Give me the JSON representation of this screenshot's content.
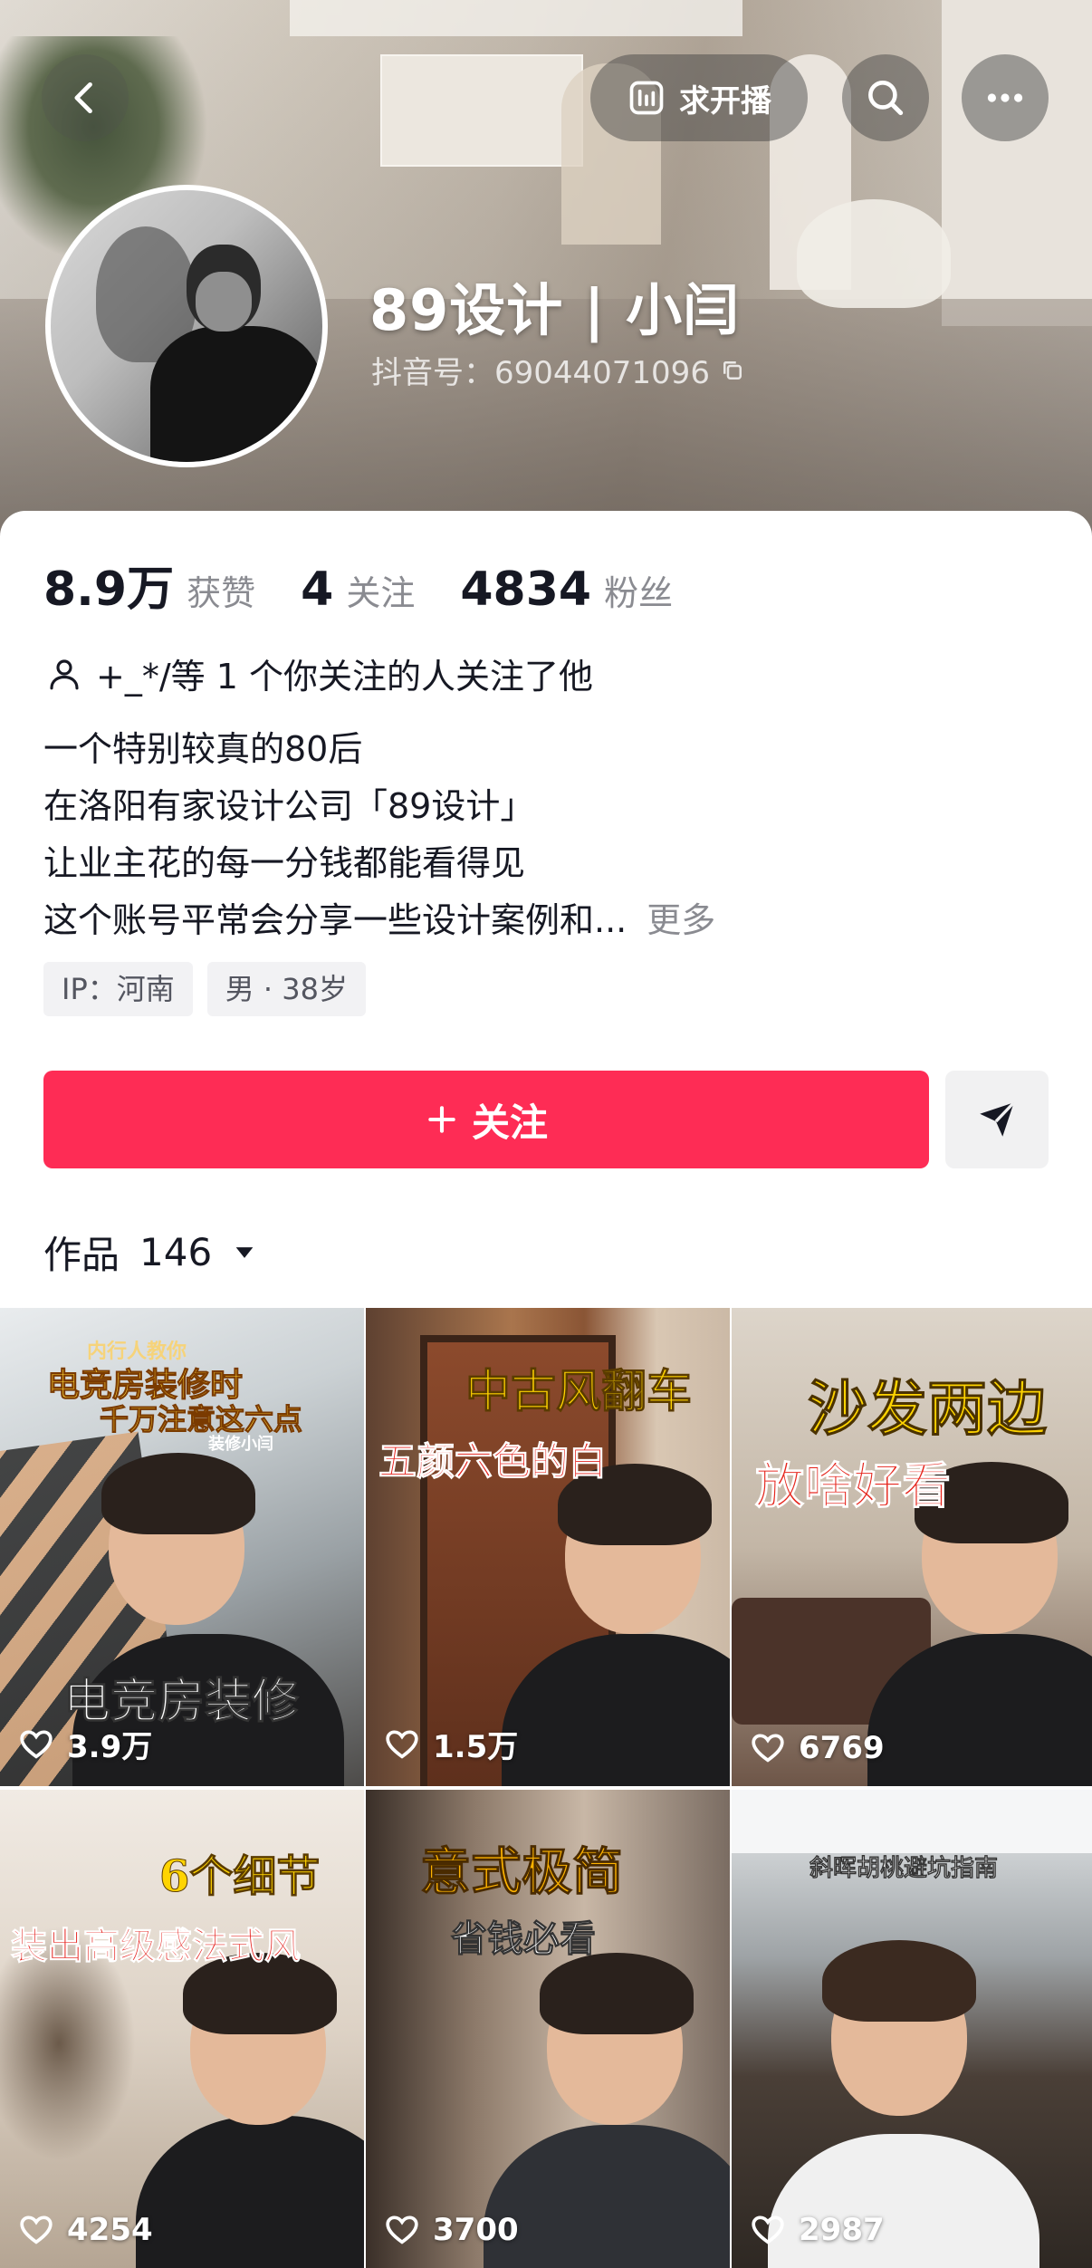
{
  "header": {
    "live_label": "求开播",
    "display_name": "89设计 | 小闫",
    "douyin_id": "抖音号：69044071096"
  },
  "stats": [
    {
      "num": "8.9万",
      "label": "获赞"
    },
    {
      "num": "4",
      "label": "关注"
    },
    {
      "num": "4834",
      "label": "粉丝"
    }
  ],
  "mutual_text": "+_*/等 1 个你关注的人关注了他",
  "bio": {
    "line1": "一个特别较真的80后",
    "line2": "在洛阳有家设计公司「89设计」",
    "line3": "让业主花的每一分钱都能看得见",
    "line4": "这个账号平常会分享一些设计案例和...",
    "more": "更多"
  },
  "tags": {
    "ip": "IP：河南",
    "gender_age": "男 · 38岁"
  },
  "follow_label": "关注",
  "works": {
    "label": "作品",
    "count": "146"
  },
  "videos": [
    {
      "top_lines": [
        "内行人教你",
        "电竞房装修时",
        "千万注意这六点"
      ],
      "sub": "装修小闫",
      "bottom": "电竞房装修",
      "likes": "3.9万"
    },
    {
      "top": "中古风翻车",
      "sub": "五颜六色的白",
      "likes": "1.5万"
    },
    {
      "top": "沙发两边",
      "sub": "放啥好看",
      "likes": "6769"
    },
    {
      "top": "6个细节",
      "sub": "装出高级感法式风",
      "likes": "4254"
    },
    {
      "top": "意式极简",
      "sub": "省钱必看",
      "likes": "3700"
    },
    {
      "top": "斜晖胡桃避坑指南",
      "likes": "2987"
    }
  ],
  "colors": {
    "accent": "#fe2c55",
    "text": "#161823",
    "muted": "#8a8b91"
  }
}
